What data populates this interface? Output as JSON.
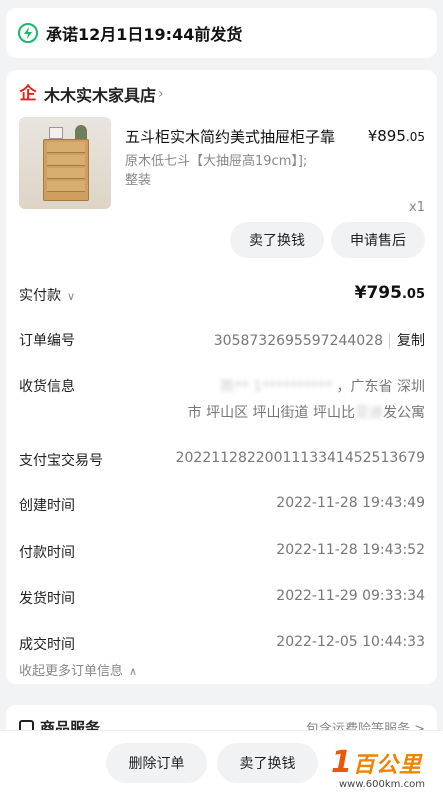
{
  "promise": {
    "text": "承诺12月1日19:44前发货"
  },
  "shop": {
    "name": "木木实木家具店"
  },
  "product": {
    "title": "五斗柜实木简约美式抽屉柜子靠",
    "price_main": "¥895",
    "price_dec": ".05",
    "spec_line1": "原木低七斗【大抽屉高19cm】];",
    "spec_line2": "整装",
    "qty": "x1"
  },
  "actions": {
    "resell": "卖了换钱",
    "after_sale": "申请售后"
  },
  "details": {
    "paid_label": "实付款",
    "paid_main": "¥795",
    "paid_dec": ".05",
    "order_no_label": "订单编号",
    "order_no": "3058732695597244028",
    "copy_label": "复制",
    "address_label": "收货信息",
    "address_blurred": "陈**  1**********  ",
    "address_visible1": "，广东省 深圳",
    "address_line2_a": "市 坪山区 坪山街道 坪山比",
    "address_line2_blur": "亚迪",
    "address_line2_b": "发公寓",
    "alipay_label": "支付宝交易号",
    "alipay_no": "2022112822001113341452513679",
    "created_label": "创建时间",
    "created_time": "2022-11-28 19:43:49",
    "paid_time_label": "付款时间",
    "paid_time": "2022-11-28 19:43:52",
    "shipped_label": "发货时间",
    "shipped_time": "2022-11-29 09:33:34",
    "deal_label": "成交时间",
    "deal_time": "2022-12-05 10:44:33",
    "collapse_label": "收起更多订单信息"
  },
  "service": {
    "label": "商品服务",
    "right": "包含运费险等服务 >"
  },
  "bottom": {
    "delete": "删除订单",
    "resell": "卖了换钱"
  },
  "watermark": {
    "brand": "百公里",
    "url": "www.600km.com"
  },
  "colors": {
    "accent_green": "#19b86b",
    "shop_red": "#e2231a",
    "watermark_orange": "#f08200"
  }
}
